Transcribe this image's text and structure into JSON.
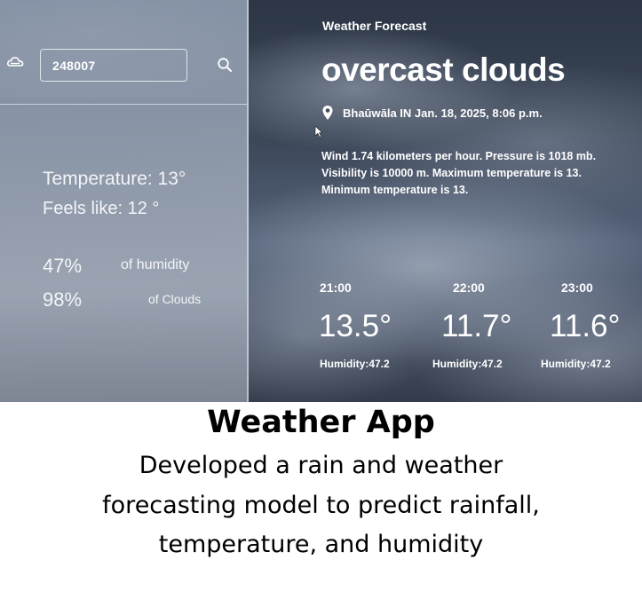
{
  "search": {
    "value": "248007"
  },
  "sidebar": {
    "temperature": "Temperature:  13°",
    "feels_like": "Feels like:  12 °",
    "humidity_value": "47%",
    "humidity_label": "of humidity",
    "clouds_value": "98%",
    "clouds_label": "of Clouds"
  },
  "main": {
    "app_title": "Weather Forecast",
    "condition": "overcast clouds",
    "location": "Bhaūwāla IN Jan. 18, 2025, 8:06 p.m.",
    "details": [
      "Wind 1.74 kilometers per hour. Pressure is 1018 mb.",
      "Visibility is 10000 m. Maximum temperature is 13.",
      "Minimum temperature is 13."
    ],
    "hourly": [
      {
        "time": "21:00",
        "temp": "13.5°",
        "humidity": "Humidity:47.2"
      },
      {
        "time": "22:00",
        "temp": "11.7°",
        "humidity": "Humidity:47.2"
      },
      {
        "time": "23:00",
        "temp": "11.6°",
        "humidity": "Humidity:47.2"
      }
    ]
  },
  "caption": {
    "title": "Weather App",
    "description": "Developed a rain and weather forecasting model to predict rainfall, temperature, and humidity"
  },
  "icons": {
    "weather": "cloud-icon",
    "search": "search-icon",
    "location": "map-pin-icon",
    "pointer": "cursor-icon"
  },
  "colors": {
    "sidebar_bg": "#8b96a7",
    "main_bg": "#3c4758",
    "text": "#ffffff",
    "caption_text": "#000000"
  }
}
